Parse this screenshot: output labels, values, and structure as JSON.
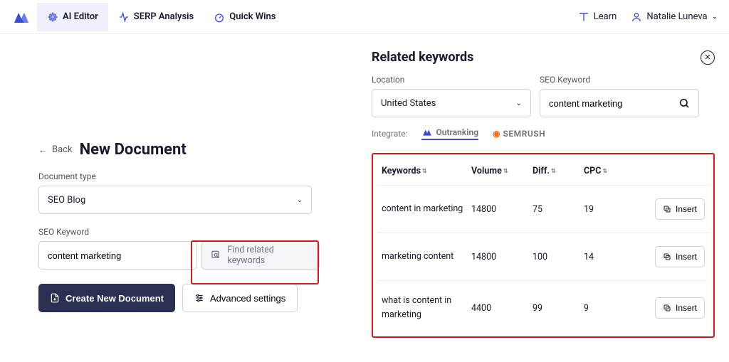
{
  "nav": {
    "tabs": [
      {
        "label": "AI Editor"
      },
      {
        "label": "SERP Analysis"
      },
      {
        "label": "Quick Wins"
      }
    ],
    "learn": "Learn",
    "user": "Natalie Luneva"
  },
  "left": {
    "back": "Back",
    "title": "New Document",
    "doc_type_label": "Document type",
    "doc_type_value": "SEO Blog",
    "seo_label": "SEO Keyword",
    "seo_value": "content marketing",
    "find_btn": "Find related keywords",
    "create_btn": "Create New Document",
    "advanced_btn": "Advanced settings"
  },
  "right": {
    "title": "Related keywords",
    "location_label": "Location",
    "location_value": "United States",
    "seo_label": "SEO Keyword",
    "seo_value": "content marketing",
    "integrate_label": "Integrate:",
    "integrations": [
      "Outranking",
      "SEMRUSH"
    ],
    "columns": {
      "kw": "Keywords",
      "vol": "Volume",
      "diff": "Diff.",
      "cpc": "CPC"
    },
    "insert_label": "Insert",
    "rows": [
      {
        "kw": "content in marketing",
        "vol": "14800",
        "diff": "75",
        "cpc": "19"
      },
      {
        "kw": "marketing content",
        "vol": "14800",
        "diff": "100",
        "cpc": "14"
      },
      {
        "kw": "what is content in marketing",
        "vol": "4400",
        "diff": "99",
        "cpc": "9"
      }
    ]
  }
}
